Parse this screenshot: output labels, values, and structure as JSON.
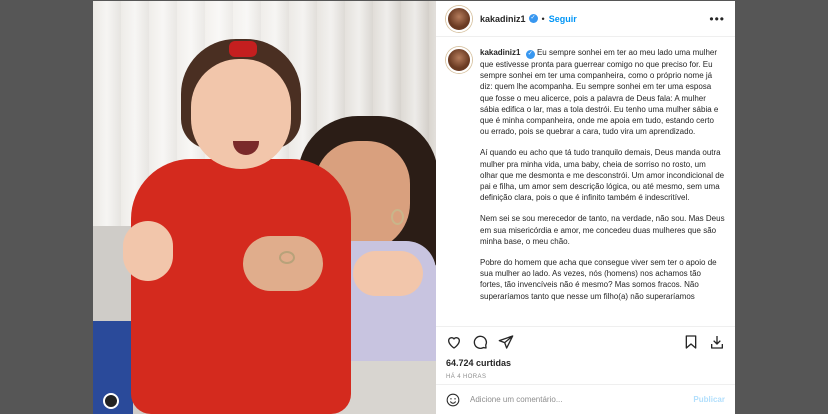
{
  "post": {
    "username": "kakadiniz1",
    "follow_label": "Seguir",
    "more_label": "•••",
    "caption_paragraphs": [
      "Eu sempre sonhei em ter ao meu lado uma mulher que estivesse pronta para guerrear comigo no que preciso for. Eu sempre sonhei em ter uma companheira, como o próprio nome já diz: quem lhe acompanha. Eu sempre sonhei em ter uma esposa que fosse o meu alicerce, pois a palavra de Deus fala: A mulher sábia edifica o lar, mas a tola destrói. Eu tenho uma mulher sábia e que é minha companheira, onde me apoia em tudo, estando certo ou errado, pois se quebrar a cara, tudo vira um aprendizado.",
      "Aí quando eu acho que tá tudo tranquilo demais, Deus manda outra mulher pra minha vida, uma baby, cheia de sorriso no rosto, um olhar que me desmonta e me desconstrói. Um amor incondicional de pai e filha, um amor sem descrição lógica, ou até mesmo, sem uma definição clara, pois o que é infinito também é indescritível.",
      "Nem sei se sou merecedor de tanto, na verdade, não sou. Mas Deus em sua misericórdia e amor, me concedeu duas mulheres que são minha base, o meu chão.",
      "Pobre do homem que acha que consegue viver sem ter o apoio de sua mulher ao lado. As vezes, nós (homens) nos achamos tão fortes, tão invencíveis não é mesmo? Mas somos fracos. Não superaríamos tanto que nesse um filho(a) não superaríamos"
    ],
    "likes": "64.724 curtidas",
    "time": "HÁ 4 HORAS",
    "comment_placeholder": "Adicione um comentário...",
    "publish_label": "Publicar"
  },
  "colors": {
    "backdrop": "#565656",
    "link_blue": "#0095f6",
    "verified_blue": "#3897f0",
    "publish_disabled": "#b2dffc"
  },
  "icons": [
    "verified-icon",
    "heart-icon",
    "comment-icon",
    "share-icon",
    "save-icon",
    "download-icon",
    "emoji-icon"
  ]
}
